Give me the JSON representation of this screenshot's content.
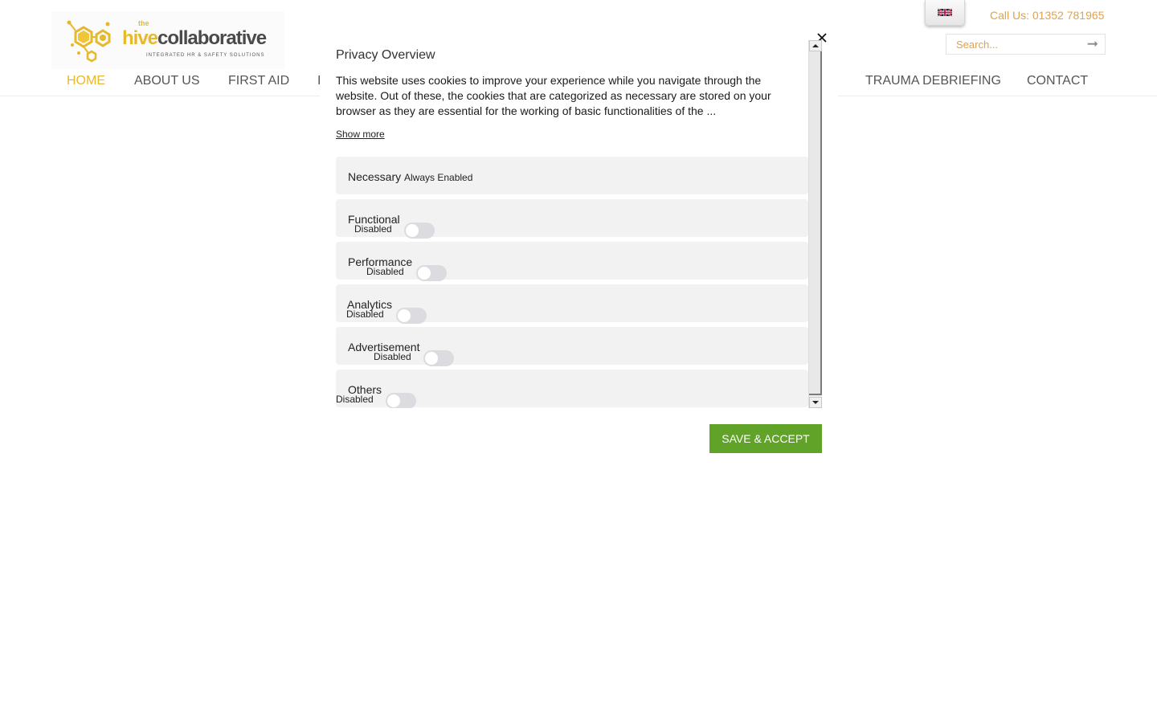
{
  "header": {
    "logo": {
      "the": "the",
      "hive": "hive",
      "collaborative": "collaborative",
      "tagline": "INTEGRATED HR & SAFETY SOLUTIONS"
    },
    "language_flag": "uk-flag-icon",
    "call_us": "Call Us: 01352 781965",
    "search": {
      "placeholder": "Search...",
      "value": "",
      "submit_icon": "arrow-right-icon"
    },
    "nav": [
      {
        "label": "HOME",
        "active": true
      },
      {
        "label": "ABOUT US",
        "active": false
      },
      {
        "label": "FIRST AID",
        "active": false
      },
      {
        "label": "I",
        "active": false
      },
      {
        "label": "TRAUMA DEBRIEFING",
        "active": false
      },
      {
        "label": "CONTACT",
        "active": false
      }
    ]
  },
  "modal": {
    "title": "Privacy Overview",
    "description": "This website uses cookies to improve your experience while you navigate through the website. Out of these, the cookies that are categorized as necessary are stored on your browser as they are essential for the working of basic functionalities of the ...",
    "show_more": "Show more",
    "categories": [
      {
        "name": "Necessary",
        "status": "Always Enabled"
      },
      {
        "name": "Functional",
        "status": "Disabled",
        "enabled": false
      },
      {
        "name": "Performance",
        "status": "Disabled",
        "enabled": false
      },
      {
        "name": "Analytics",
        "status": "Disabled",
        "enabled": false
      },
      {
        "name": "Advertisement",
        "status": "Disabled",
        "enabled": false
      },
      {
        "name": "Others",
        "status": "Disabled",
        "enabled": false
      }
    ],
    "save_button": "SAVE & ACCEPT",
    "close_icon": "close-icon"
  },
  "colors": {
    "brand_yellow": "#e7b92a",
    "call_us_orange": "#e0a24a",
    "accept_green": "#61a229",
    "category_bg": "#f2f2f2",
    "toggle_off": "#dcdce0"
  }
}
